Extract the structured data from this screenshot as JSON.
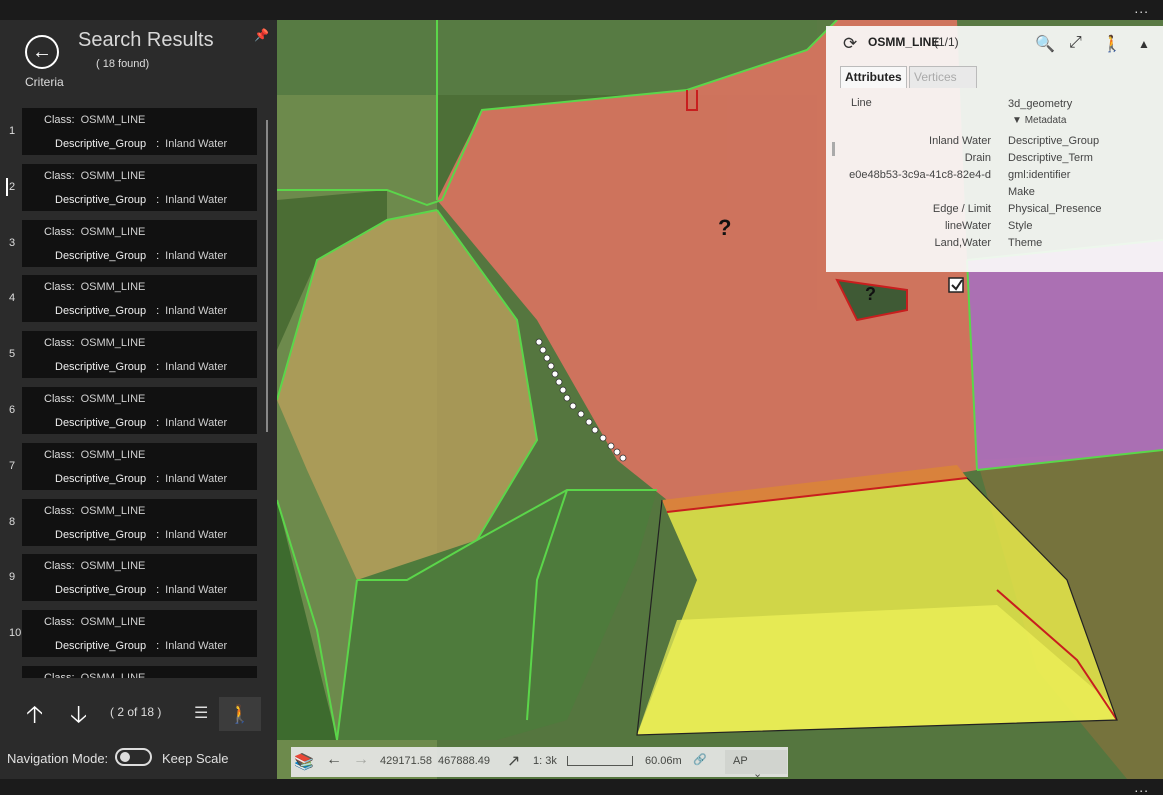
{
  "window": {
    "menu_dots": "...",
    "bottom_dots": "..."
  },
  "sidebar": {
    "title": "Search Results",
    "count": "( 18 found)",
    "criteria_label": "Criteria",
    "results": [
      {
        "num": "1",
        "class_label": "Class:",
        "class_value": "OSMM_LINE",
        "group_label": "Descriptive_Group",
        "sep": ":",
        "group_value": "Inland Water"
      },
      {
        "num": "2",
        "class_label": "Class:",
        "class_value": "OSMM_LINE",
        "group_label": "Descriptive_Group",
        "sep": ":",
        "group_value": "Inland Water"
      },
      {
        "num": "3",
        "class_label": "Class:",
        "class_value": "OSMM_LINE",
        "group_label": "Descriptive_Group",
        "sep": ":",
        "group_value": "Inland Water"
      },
      {
        "num": "4",
        "class_label": "Class:",
        "class_value": "OSMM_LINE",
        "group_label": "Descriptive_Group",
        "sep": ":",
        "group_value": "Inland Water"
      },
      {
        "num": "5",
        "class_label": "Class:",
        "class_value": "OSMM_LINE",
        "group_label": "Descriptive_Group",
        "sep": ":",
        "group_value": "Inland Water"
      },
      {
        "num": "6",
        "class_label": "Class:",
        "class_value": "OSMM_LINE",
        "group_label": "Descriptive_Group",
        "sep": ":",
        "group_value": "Inland Water"
      },
      {
        "num": "7",
        "class_label": "Class:",
        "class_value": "OSMM_LINE",
        "group_label": "Descriptive_Group",
        "sep": ":",
        "group_value": "Inland Water"
      },
      {
        "num": "8",
        "class_label": "Class:",
        "class_value": "OSMM_LINE",
        "group_label": "Descriptive_Group",
        "sep": ":",
        "group_value": "Inland Water"
      },
      {
        "num": "9",
        "class_label": "Class:",
        "class_value": "OSMM_LINE",
        "group_label": "Descriptive_Group",
        "sep": ":",
        "group_value": "Inland Water"
      },
      {
        "num": "10",
        "class_label": "Class:",
        "class_value": "OSMM_LINE",
        "group_label": "Descriptive_Group",
        "sep": ":",
        "group_value": "Inland Water"
      },
      {
        "num": "",
        "class_label": "Class:",
        "class_value": "OSMM_LINE",
        "group_label": "",
        "sep": "",
        "group_value": ""
      }
    ],
    "pager": "( 2  of  18 )",
    "navigation_mode_label": "Navigation Mode:",
    "keep_scale_label": "Keep Scale",
    "icons": [
      "back-arrow-icon",
      "pin-icon",
      "up-arrow-icon",
      "down-arrow-icon",
      "checklist-icon",
      "walk-icon"
    ]
  },
  "info_panel": {
    "title": "OSMM_LINE",
    "count": "(1/1)",
    "tabs": [
      "Attributes",
      "Vertices"
    ],
    "active_tab": "Attributes",
    "left_values": [
      "Line",
      "Inland Water",
      "Drain",
      "e0e48b53-3c9a-41c8-82e4-d",
      "Edge / Limit",
      "lineWater",
      "Land,Water"
    ],
    "right_labels": [
      "3d_geometry",
      "Metadata",
      "Descriptive_Group",
      "Descriptive_Term",
      "gml:identifier",
      "Make",
      "Physical_Presence",
      "Style",
      "Theme"
    ]
  },
  "map": {
    "markers": [
      "?",
      "?"
    ],
    "colors": {
      "red_field": "#d9735f",
      "yellow_field": "#e6e84a",
      "purple_field": "#b46fc0",
      "boundary_green": "#5bd64a",
      "boundary_red": "#c81e1e"
    }
  },
  "statusbar": {
    "x": "429171.58",
    "y": "467888.49",
    "scale": "1: 3k",
    "distance": "60.06m",
    "layer": "AP"
  }
}
